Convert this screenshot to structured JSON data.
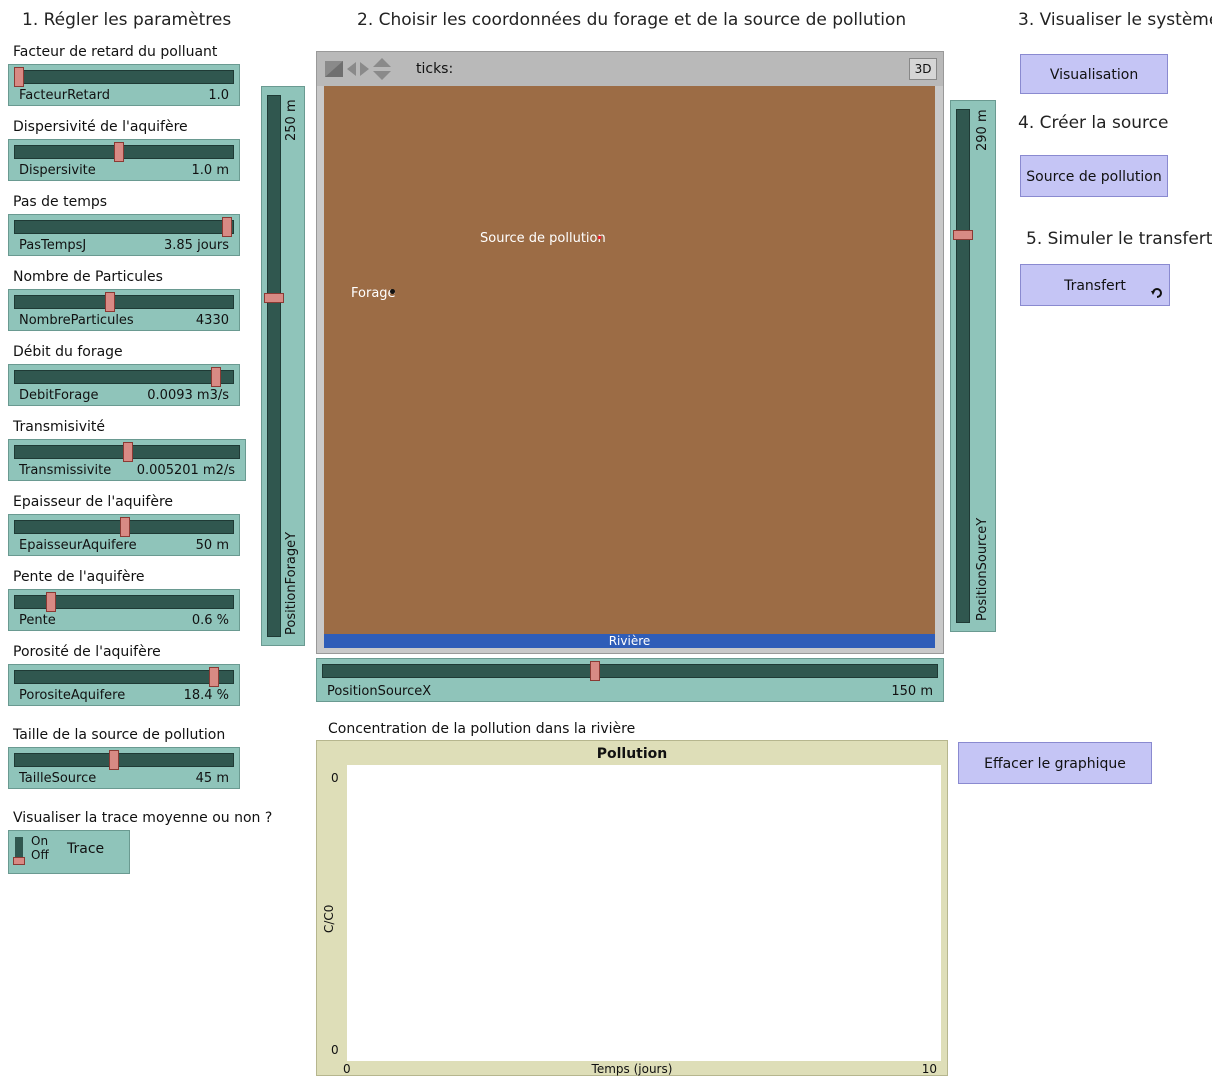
{
  "sections": {
    "params": "1. Régler les paramètres",
    "coords": "2. Choisir les coordonnées du forage et de la source de pollution",
    "visualize": "3. Visualiser le système",
    "create": "4. Créer la source",
    "simulate": "5. Simuler le transfert"
  },
  "sliders": [
    {
      "title": "Facteur de retard du polluant",
      "name": "FacteurRetard",
      "value": "1.0",
      "fraction": 0.0
    },
    {
      "title": "Dispersivité de l'aquifère",
      "name": "Dispersivite",
      "value": "1.0 m",
      "fraction": 0.47
    },
    {
      "title": "Pas de temps",
      "name": "PasTempsJ",
      "value": "3.85 jours",
      "fraction": 0.98
    },
    {
      "title": "Nombre de Particules",
      "name": "NombreParticules",
      "value": "4330",
      "fraction": 0.43
    },
    {
      "title": "Débit du forage",
      "name": "DebitForage",
      "value": "0.0093 m3/s",
      "fraction": 0.93
    },
    {
      "title": "Transmisivité",
      "name": "Transmissivite",
      "value": "0.005201 m2/s",
      "fraction": 0.5
    },
    {
      "title": "Epaisseur de l'aquifère",
      "name": "EpaisseurAquifere",
      "value": "50 m",
      "fraction": 0.5
    },
    {
      "title": "Pente de l'aquifère",
      "name": "Pente",
      "value": "0.6 %",
      "fraction": 0.15
    },
    {
      "title": "Porosité de l'aquifère",
      "name": "PorositeAquifere",
      "value": "18.4 %",
      "fraction": 0.92
    },
    {
      "title": "Taille de la source de pollution",
      "name": "TailleSource",
      "value": "45 m",
      "fraction": 0.45
    }
  ],
  "trace": {
    "title": "Visualiser la trace moyenne ou non ?",
    "on": "On",
    "off": "Off",
    "name": "Trace",
    "state": "off"
  },
  "forageY": {
    "name": "PositionForageY",
    "value": "250 m",
    "fraction": 0.37
  },
  "sourceY": {
    "name": "PositionSourceY",
    "value": "290 m",
    "fraction": 0.24
  },
  "sourceX": {
    "name": "PositionSourceX",
    "value": "150 m",
    "fraction": 0.44
  },
  "world": {
    "ticks": "ticks:",
    "three_d": "3D",
    "source_label": "Source de pollution",
    "forage_label": "Forage",
    "river_label": "Rivière"
  },
  "buttons": {
    "visualisation": "Visualisation",
    "source": "Source de pollution",
    "transfert": "Transfert",
    "clear": "Effacer le graphique"
  },
  "plot": {
    "caption": "Concentration de la pollution dans la rivière",
    "title": "Pollution",
    "ylabel": "C/C0",
    "xlabel": "Temps (jours)",
    "y_top": "0",
    "y_bottom": "0",
    "x_min": "0",
    "x_max": "10"
  },
  "colors": {
    "slider_bg": "#8fc4ba",
    "track": "#30574f",
    "knob": "#d88a84",
    "button": "#c5c5f5",
    "patch": "#9c6c45",
    "river": "#2f5db8"
  }
}
